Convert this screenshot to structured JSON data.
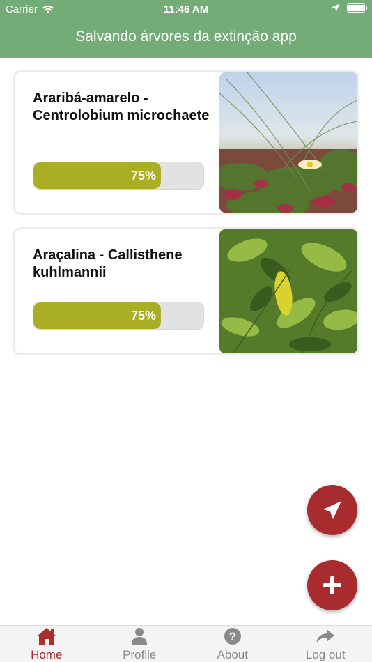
{
  "status_bar": {
    "carrier": "Carrier",
    "time": "11:46 AM"
  },
  "header": {
    "title": "Salvando árvores da extinção app"
  },
  "trees": [
    {
      "name": "Araribá-amarelo - Centrolobium microchaete",
      "progress_label": "75%",
      "progress": 0.75,
      "image": "flower-photo"
    },
    {
      "name": "Araçalina - Callisthene kuhlmannii",
      "progress_label": "75%",
      "progress": 0.75,
      "image": "leaves-photo"
    }
  ],
  "actions": {
    "send_icon": "paper-plane-icon",
    "add_icon": "plus-icon"
  },
  "tabs": [
    {
      "label": "Home",
      "icon": "home-icon",
      "active": true
    },
    {
      "label": "Profile",
      "icon": "user-icon",
      "active": false
    },
    {
      "label": "About",
      "icon": "question-icon",
      "active": false
    },
    {
      "label": "Log out",
      "icon": "share-arrow-icon",
      "active": false
    }
  ],
  "colors": {
    "header": "#74ac77",
    "progress_fill": "#a9ae25",
    "accent": "#a82b2e"
  }
}
